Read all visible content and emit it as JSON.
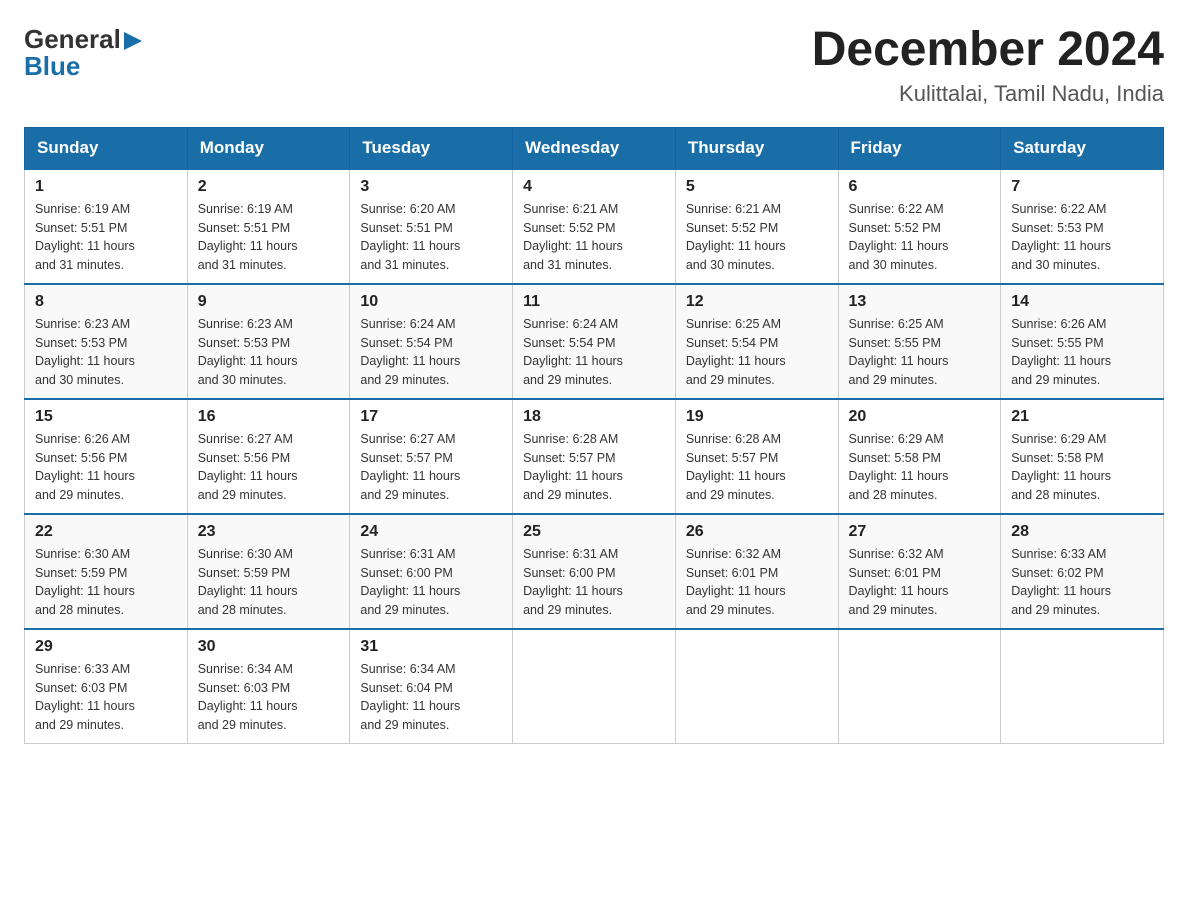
{
  "logo": {
    "general": "General",
    "blue": "Blue",
    "arrow_color": "#1a6ea8"
  },
  "title": {
    "month_year": "December 2024",
    "location": "Kulittalai, Tamil Nadu, India"
  },
  "header_color": "#1a6ea8",
  "days_of_week": [
    "Sunday",
    "Monday",
    "Tuesday",
    "Wednesday",
    "Thursday",
    "Friday",
    "Saturday"
  ],
  "weeks": [
    [
      {
        "day": "1",
        "sunrise": "6:19 AM",
        "sunset": "5:51 PM",
        "daylight": "11 hours and 31 minutes."
      },
      {
        "day": "2",
        "sunrise": "6:19 AM",
        "sunset": "5:51 PM",
        "daylight": "11 hours and 31 minutes."
      },
      {
        "day": "3",
        "sunrise": "6:20 AM",
        "sunset": "5:51 PM",
        "daylight": "11 hours and 31 minutes."
      },
      {
        "day": "4",
        "sunrise": "6:21 AM",
        "sunset": "5:52 PM",
        "daylight": "11 hours and 31 minutes."
      },
      {
        "day": "5",
        "sunrise": "6:21 AM",
        "sunset": "5:52 PM",
        "daylight": "11 hours and 30 minutes."
      },
      {
        "day": "6",
        "sunrise": "6:22 AM",
        "sunset": "5:52 PM",
        "daylight": "11 hours and 30 minutes."
      },
      {
        "day": "7",
        "sunrise": "6:22 AM",
        "sunset": "5:53 PM",
        "daylight": "11 hours and 30 minutes."
      }
    ],
    [
      {
        "day": "8",
        "sunrise": "6:23 AM",
        "sunset": "5:53 PM",
        "daylight": "11 hours and 30 minutes."
      },
      {
        "day": "9",
        "sunrise": "6:23 AM",
        "sunset": "5:53 PM",
        "daylight": "11 hours and 30 minutes."
      },
      {
        "day": "10",
        "sunrise": "6:24 AM",
        "sunset": "5:54 PM",
        "daylight": "11 hours and 29 minutes."
      },
      {
        "day": "11",
        "sunrise": "6:24 AM",
        "sunset": "5:54 PM",
        "daylight": "11 hours and 29 minutes."
      },
      {
        "day": "12",
        "sunrise": "6:25 AM",
        "sunset": "5:54 PM",
        "daylight": "11 hours and 29 minutes."
      },
      {
        "day": "13",
        "sunrise": "6:25 AM",
        "sunset": "5:55 PM",
        "daylight": "11 hours and 29 minutes."
      },
      {
        "day": "14",
        "sunrise": "6:26 AM",
        "sunset": "5:55 PM",
        "daylight": "11 hours and 29 minutes."
      }
    ],
    [
      {
        "day": "15",
        "sunrise": "6:26 AM",
        "sunset": "5:56 PM",
        "daylight": "11 hours and 29 minutes."
      },
      {
        "day": "16",
        "sunrise": "6:27 AM",
        "sunset": "5:56 PM",
        "daylight": "11 hours and 29 minutes."
      },
      {
        "day": "17",
        "sunrise": "6:27 AM",
        "sunset": "5:57 PM",
        "daylight": "11 hours and 29 minutes."
      },
      {
        "day": "18",
        "sunrise": "6:28 AM",
        "sunset": "5:57 PM",
        "daylight": "11 hours and 29 minutes."
      },
      {
        "day": "19",
        "sunrise": "6:28 AM",
        "sunset": "5:57 PM",
        "daylight": "11 hours and 29 minutes."
      },
      {
        "day": "20",
        "sunrise": "6:29 AM",
        "sunset": "5:58 PM",
        "daylight": "11 hours and 28 minutes."
      },
      {
        "day": "21",
        "sunrise": "6:29 AM",
        "sunset": "5:58 PM",
        "daylight": "11 hours and 28 minutes."
      }
    ],
    [
      {
        "day": "22",
        "sunrise": "6:30 AM",
        "sunset": "5:59 PM",
        "daylight": "11 hours and 28 minutes."
      },
      {
        "day": "23",
        "sunrise": "6:30 AM",
        "sunset": "5:59 PM",
        "daylight": "11 hours and 28 minutes."
      },
      {
        "day": "24",
        "sunrise": "6:31 AM",
        "sunset": "6:00 PM",
        "daylight": "11 hours and 29 minutes."
      },
      {
        "day": "25",
        "sunrise": "6:31 AM",
        "sunset": "6:00 PM",
        "daylight": "11 hours and 29 minutes."
      },
      {
        "day": "26",
        "sunrise": "6:32 AM",
        "sunset": "6:01 PM",
        "daylight": "11 hours and 29 minutes."
      },
      {
        "day": "27",
        "sunrise": "6:32 AM",
        "sunset": "6:01 PM",
        "daylight": "11 hours and 29 minutes."
      },
      {
        "day": "28",
        "sunrise": "6:33 AM",
        "sunset": "6:02 PM",
        "daylight": "11 hours and 29 minutes."
      }
    ],
    [
      {
        "day": "29",
        "sunrise": "6:33 AM",
        "sunset": "6:03 PM",
        "daylight": "11 hours and 29 minutes."
      },
      {
        "day": "30",
        "sunrise": "6:34 AM",
        "sunset": "6:03 PM",
        "daylight": "11 hours and 29 minutes."
      },
      {
        "day": "31",
        "sunrise": "6:34 AM",
        "sunset": "6:04 PM",
        "daylight": "11 hours and 29 minutes."
      },
      null,
      null,
      null,
      null
    ]
  ],
  "labels": {
    "sunrise": "Sunrise:",
    "sunset": "Sunset:",
    "daylight": "Daylight:"
  }
}
